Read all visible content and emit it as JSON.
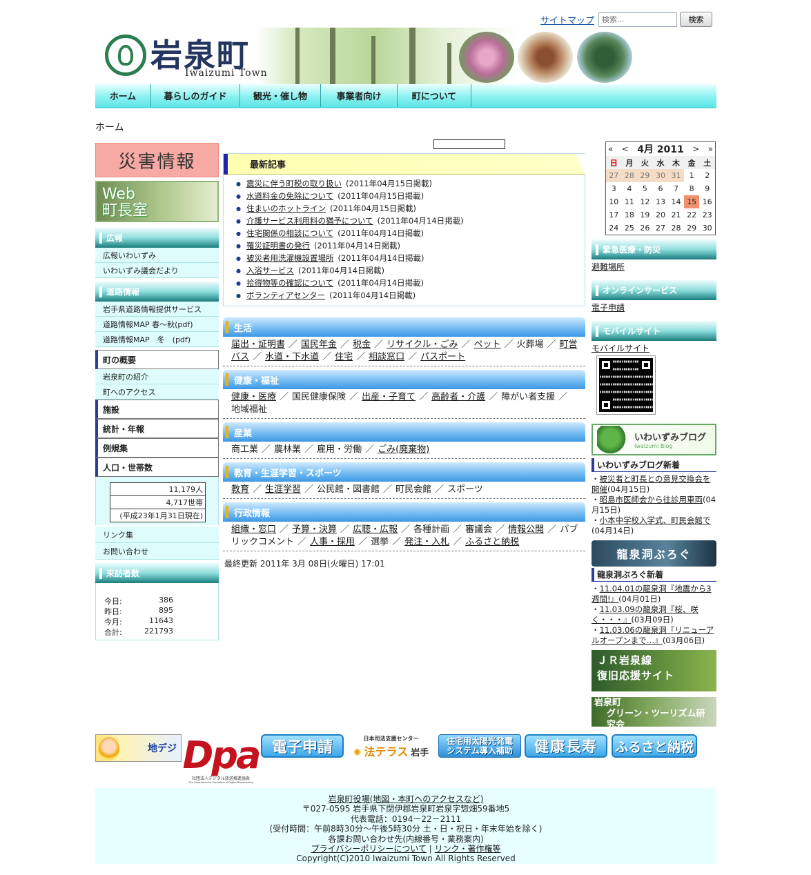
{
  "header": {
    "sitemap": "サイトマップ",
    "search_placeholder": "検索...",
    "search_button": "検索",
    "logo_title": "岩泉町",
    "logo_subtitle": "Iwaizumi Town"
  },
  "nav": [
    "ホーム",
    "暮らしのガイド",
    "観光・催し物",
    "事業者向け",
    "町について"
  ],
  "breadcrumb": "ホーム",
  "left": {
    "disaster": "災害情報",
    "mayor_line1": "Web",
    "mayor_line2": "町長室",
    "koho_head": "広報",
    "koho_items": [
      "広報いわいずみ",
      "いわいずみ議会だより"
    ],
    "road_head": "道路情報",
    "road_items": [
      "岩手県道路情報提供サービス",
      "道路情報MAP 春〜秋(pdf)",
      "道路情報MAP　冬　(pdf)"
    ],
    "overview_head": "町の概要",
    "overview_items": [
      "岩泉町の紹介",
      "町へのアクセス"
    ],
    "facility_head": "施設",
    "stats_head": "統計・年報",
    "reiki_head": "例規集",
    "pop_head": "人口・世帯数",
    "pop": [
      "11,179人",
      "4,717世帯",
      "(平成23年1月31日現在)"
    ],
    "links": "リンク集",
    "contact": "お問い合わせ",
    "visitors_head": "来訪者数",
    "visitors": [
      {
        "label": "今日:",
        "value": "386"
      },
      {
        "label": "昨日:",
        "value": "895"
      },
      {
        "label": "今月:",
        "value": "11643"
      },
      {
        "label": "合計:",
        "value": "221793"
      }
    ]
  },
  "latest": {
    "head": "最新記事",
    "items": [
      {
        "title": "震災に伴う町税の取り扱い",
        "date": "(2011年04月15日掲載)"
      },
      {
        "title": "水道料金の免除について",
        "date": "(2011年04月15日掲載)"
      },
      {
        "title": "住まいのホットライン",
        "date": "(2011年04月15日掲載)"
      },
      {
        "title": "介護サービス利用料の猶予について",
        "date": "(2011年04月14日掲載)"
      },
      {
        "title": "住宅関係の相談について",
        "date": "(2011年04月14日掲載)"
      },
      {
        "title": "罹災証明書の発行",
        "date": "(2011年04月14日掲載)"
      },
      {
        "title": "被災者用洗濯機設置場所",
        "date": "(2011年04月14日掲載)"
      },
      {
        "title": "入浴サービス",
        "date": "(2011年04月14日掲載)"
      },
      {
        "title": "拾得物等の確認について",
        "date": "(2011年04月14日掲載)"
      },
      {
        "title": "ボランティアセンター",
        "date": "(2011年04月14日掲載)"
      }
    ]
  },
  "categories": [
    {
      "head": "生活",
      "links": [
        {
          "t": "届出・証明書",
          "u": true
        },
        {
          "t": "国民年金",
          "u": true
        },
        {
          "t": "税金",
          "u": true
        },
        {
          "t": "リサイクル・ごみ",
          "u": true
        },
        {
          "t": "ペット",
          "u": true
        },
        {
          "t": "火葬場",
          "u": false
        },
        {
          "t": "町営バス",
          "u": true
        },
        {
          "t": "水道・下水道",
          "u": true
        },
        {
          "t": "住宅",
          "u": true
        },
        {
          "t": "相談窓口",
          "u": true
        },
        {
          "t": "パスポート",
          "u": true
        }
      ]
    },
    {
      "head": "健康・福祉",
      "links": [
        {
          "t": "健康・医療",
          "u": true
        },
        {
          "t": "国民健康保険",
          "u": false
        },
        {
          "t": "出産・子育て",
          "u": true
        },
        {
          "t": "高齢者・介護",
          "u": true
        },
        {
          "t": "障がい者支援",
          "u": false
        },
        {
          "t": "地域福祉",
          "u": false
        }
      ]
    },
    {
      "head": "産業",
      "links": [
        {
          "t": "商工業",
          "u": false
        },
        {
          "t": "農林業",
          "u": false
        },
        {
          "t": "雇用・労働",
          "u": false
        },
        {
          "t": "ごみ(廃棄物)",
          "u": true
        }
      ]
    },
    {
      "head": "教育・生涯学習・スポーツ",
      "links": [
        {
          "t": "教育",
          "u": true
        },
        {
          "t": "生涯学習",
          "u": true
        },
        {
          "t": "公民館・図書館",
          "u": false
        },
        {
          "t": "町民会館",
          "u": false
        },
        {
          "t": "スポーツ",
          "u": false
        }
      ]
    },
    {
      "head": "行政情報",
      "links": [
        {
          "t": "組織・窓口",
          "u": true
        },
        {
          "t": "予算・決算",
          "u": true
        },
        {
          "t": "広聴・広報",
          "u": true
        },
        {
          "t": "各種計画",
          "u": false
        },
        {
          "t": "審議会",
          "u": false
        },
        {
          "t": "情報公開",
          "u": true
        },
        {
          "t": "パブリックコメント",
          "u": false
        },
        {
          "t": "人事・採用",
          "u": true
        },
        {
          "t": "選挙",
          "u": false
        },
        {
          "t": "発注・入札",
          "u": true
        },
        {
          "t": "ふるさと納税",
          "u": true
        }
      ]
    }
  ],
  "last_update": "最終更新 2011年 3月 08日(火曜日) 17:01",
  "calendar": {
    "prev_year": "«",
    "prev_month": "<",
    "month": "4月 2011",
    "next_month": ">",
    "next_year": "»",
    "weekdays": [
      "日",
      "月",
      "火",
      "水",
      "木",
      "金",
      "土"
    ],
    "weeks": [
      [
        "27",
        "28",
        "29",
        "30",
        "31",
        "1",
        "2"
      ],
      [
        "3",
        "4",
        "5",
        "6",
        "7",
        "8",
        "9"
      ],
      [
        "10",
        "11",
        "12",
        "13",
        "14",
        "15",
        "16"
      ],
      [
        "17",
        "18",
        "19",
        "20",
        "21",
        "22",
        "23"
      ],
      [
        "24",
        "25",
        "26",
        "27",
        "28",
        "29",
        "30"
      ]
    ],
    "today": "15"
  },
  "right": {
    "emergency_head": "緊急医療・防災",
    "emergency_link": "避難場所",
    "online_head": "オンラインサービス",
    "online_link": "電子申請",
    "mobile_head": "モバイルサイト",
    "mobile_link": "モバイルサイト",
    "blog_banner": "いわいずみブログ",
    "blog_banner_sub": "Iwaizumi Blog",
    "blog_head": "いわいずみブログ新着",
    "blog_items": [
      {
        "title": "被災者と町長との意見交換会を開催",
        "date": "(04月15日)"
      },
      {
        "title": "昭島市医師会から往診用車両",
        "date": "(04月15日)"
      },
      {
        "title": "小本中学校入学式、町民会館で",
        "date": "(04月14日)"
      }
    ],
    "ryusendo_banner": "龍泉洞ぶろぐ",
    "ryusendo_head": "龍泉洞ぶろぐ新着",
    "ryusendo_items": [
      {
        "title": "11.04.01の龍泉洞『地震から3週間!』",
        "date": "(04月01日)"
      },
      {
        "title": "11.03.09の龍泉洞『桜、咲く・・・』",
        "date": "(03月09日)"
      },
      {
        "title": "11.03.06の龍泉洞『リニューアルオープンまで…』",
        "date": "(03月06日)"
      }
    ],
    "jr_banner_line1": "ＪＲ岩泉線",
    "jr_banner_line2": "復旧応援サイト",
    "gt_banner_line1": "岩泉町",
    "gt_banner_line2": "グリーン・ツーリズム研究会"
  },
  "banners": {
    "chideji": "地デジ",
    "dpa": "Dpa",
    "dpa_caption": "社団法人デジタル放送推進協会",
    "dpa_caption_en": "The Association for Promotion of Digital Broadcasting",
    "denshi": "電子申請",
    "houterasu_top": "日本司法支援センター",
    "houterasu": "法テラス",
    "houterasu_place": "岩手",
    "solar_line1": "住宅用太陽光発電",
    "solar_line2": "システム導入補助",
    "kenko": "健康長寿",
    "furusato": "ふるさと納税"
  },
  "footer": {
    "line1": "岩泉町役場(地図・本町へのアクセスなど)",
    "line2": "〒027-0595 岩手県下閉伊郡岩泉町岩泉字惣畑59番地5",
    "line3": "代表電話：0194－22－2111",
    "line4": "(受付時間：午前8時30分〜午後5時30分 土・日・祝日・年末年始を除く)",
    "line5": "各課お問い合わせ先(内線番号・業務案内)",
    "privacy": "プライバシーポリシーについて",
    "divider": "|",
    "copyright_link": "リンク・著作権等",
    "copyright": "Copyright(C)2010 Iwaizumi Town All Rights Reserved"
  }
}
